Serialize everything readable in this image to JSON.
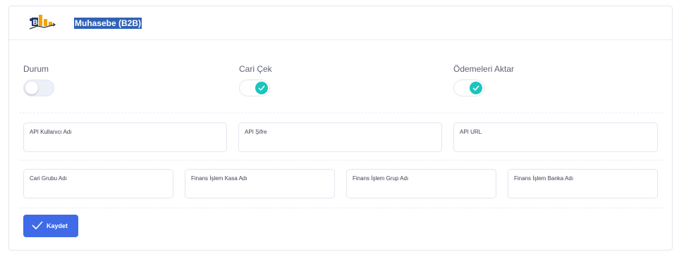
{
  "header": {
    "title": "Muhasebe (B2B)",
    "logo_icon": "b2b-chart-logo-icon"
  },
  "toggles": [
    {
      "label": "Durum",
      "checked": false
    },
    {
      "label": "Cari Çek",
      "checked": true
    },
    {
      "label": "Ödemeleri Aktar",
      "checked": true
    }
  ],
  "fields_row1": [
    {
      "label": "API Kullanıcı Adı",
      "value": ""
    },
    {
      "label": "API Şifre",
      "value": ""
    },
    {
      "label": "API URL",
      "value": ""
    }
  ],
  "fields_row2": [
    {
      "label": "Cari Grubu Adı",
      "value": ""
    },
    {
      "label": "Finans İşlem Kasa Adı",
      "value": ""
    },
    {
      "label": "Finans İşlem Grup Adı",
      "value": ""
    },
    {
      "label": "Finans İşlem Banka Adı",
      "value": ""
    }
  ],
  "actions": {
    "save_label": "Kaydet",
    "save_icon": "check-icon"
  },
  "colors": {
    "accent": "#3f6ae8",
    "toggle_on": "#1bc5bd",
    "title_highlight": "#2f62b6"
  }
}
